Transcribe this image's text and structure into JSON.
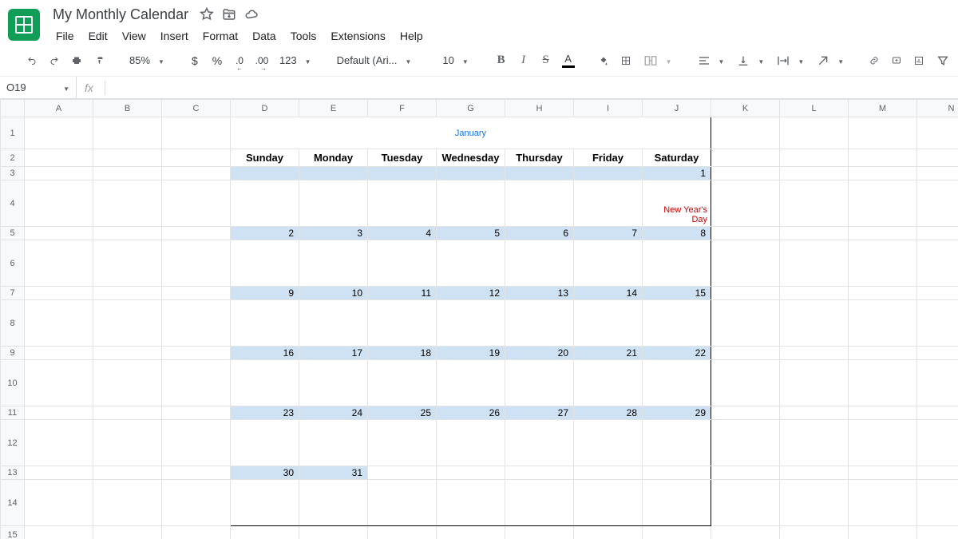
{
  "doc": {
    "title": "My Monthly Calendar"
  },
  "menu": {
    "file": "File",
    "edit": "Edit",
    "view": "View",
    "insert": "Insert",
    "format": "Format",
    "data": "Data",
    "tools": "Tools",
    "extensions": "Extensions",
    "help": "Help"
  },
  "toolbar": {
    "zoom": "85%",
    "currency": "$",
    "percent": "%",
    "decminus": ".0",
    "decplus": ".00",
    "numfmt": "123",
    "font": "Default (Ari...",
    "fontsize": "10",
    "bold": "B",
    "italic": "I",
    "strike": "S",
    "textcolor": "A"
  },
  "formula": {
    "cellref": "O19",
    "fxlabel": "fx"
  },
  "columns": [
    "",
    "A",
    "B",
    "C",
    "D",
    "E",
    "F",
    "G",
    "H",
    "I",
    "J",
    "K",
    "L",
    "M",
    "N"
  ],
  "rows": [
    "1",
    "2",
    "3",
    "4",
    "5",
    "6",
    "7",
    "8",
    "9",
    "10",
    "11",
    "12",
    "13",
    "14",
    "15"
  ],
  "calendar": {
    "month": "January",
    "weekdays": [
      "Sunday",
      "Monday",
      "Tuesday",
      "Wednesday",
      "Thursday",
      "Friday",
      "Saturday"
    ],
    "weeks": [
      {
        "dates": [
          "",
          "",
          "",
          "",
          "",
          "",
          "1"
        ],
        "events": [
          "",
          "",
          "",
          "",
          "",
          "",
          "New Year's Day"
        ]
      },
      {
        "dates": [
          "2",
          "3",
          "4",
          "5",
          "6",
          "7",
          "8"
        ],
        "events": [
          "",
          "",
          "",
          "",
          "",
          "",
          ""
        ]
      },
      {
        "dates": [
          "9",
          "10",
          "11",
          "12",
          "13",
          "14",
          "15"
        ],
        "events": [
          "",
          "",
          "",
          "",
          "",
          "",
          ""
        ]
      },
      {
        "dates": [
          "16",
          "17",
          "18",
          "19",
          "20",
          "21",
          "22"
        ],
        "events": [
          "",
          "",
          "",
          "",
          "",
          "",
          ""
        ]
      },
      {
        "dates": [
          "23",
          "24",
          "25",
          "26",
          "27",
          "28",
          "29"
        ],
        "events": [
          "",
          "",
          "",
          "",
          "",
          "",
          ""
        ]
      },
      {
        "dates": [
          "30",
          "31",
          "",
          "",
          "",
          "",
          ""
        ],
        "events": [
          "",
          "",
          "",
          "",
          "",
          "",
          ""
        ]
      }
    ]
  }
}
